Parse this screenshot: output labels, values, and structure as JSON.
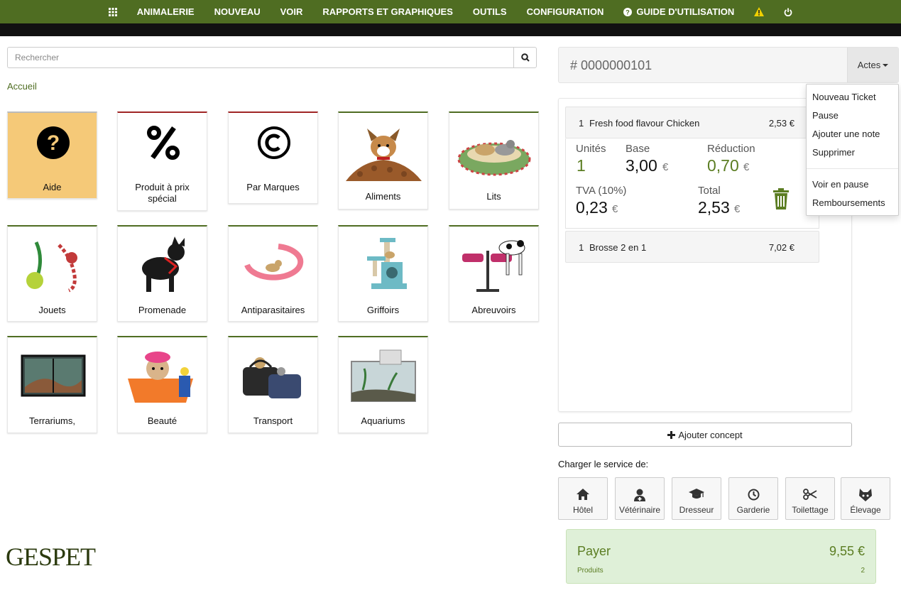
{
  "nav": {
    "items": [
      {
        "label": ""
      },
      {
        "label": "ANIMALERIE"
      },
      {
        "label": "NOUVEAU"
      },
      {
        "label": "VOIR"
      },
      {
        "label": "RAPPORTS ET GRAPHIQUES"
      },
      {
        "label": "OUTILS"
      },
      {
        "label": "CONFIGURATION"
      },
      {
        "label": "GUIDE D'UTILISATION"
      },
      {
        "label": ""
      },
      {
        "label": ""
      }
    ],
    "icons": [
      "grid-icon",
      "question-circle-icon",
      "warning-icon",
      "power-icon"
    ]
  },
  "search": {
    "placeholder": "Rechercher",
    "value": ""
  },
  "breadcrumb": "Accueil",
  "tiles": [
    {
      "label": "Aide"
    },
    {
      "label": "Produit à prix spécial"
    },
    {
      "label": "Par Marques"
    },
    {
      "label": "Aliments"
    },
    {
      "label": "Lits"
    },
    {
      "label": "Jouets"
    },
    {
      "label": "Promenade"
    },
    {
      "label": "Antiparasitaires"
    },
    {
      "label": "Griffoirs"
    },
    {
      "label": "Abreuvoirs"
    },
    {
      "label": "Terrariums,"
    },
    {
      "label": "Beauté"
    },
    {
      "label": "Transport"
    },
    {
      "label": "Aquariums"
    }
  ],
  "ticket": {
    "hash": "#",
    "number": "0000000101",
    "actes": "Actes",
    "lines": [
      {
        "qty": "1",
        "name": "Fresh food flavour Chicken",
        "price": "2,53 €"
      },
      {
        "qty": "1",
        "name": "Brosse 2 en 1",
        "price": "7,02 €"
      }
    ],
    "detail": {
      "units_label": "Unités",
      "units": "1",
      "base_label": "Base",
      "base": "3,00",
      "reduction_label": "Réduction",
      "reduction": "0,70",
      "tva_label": "TVA (10%)",
      "tva": "0,23",
      "total_label": "Total",
      "total": "2,53",
      "currency": "€"
    }
  },
  "dropdown": {
    "items": [
      "Nouveau Ticket",
      "Pause",
      "Ajouter une note",
      "Supprimer",
      "Voir en pause",
      "Remboursements"
    ]
  },
  "add_concept": "Ajouter concept",
  "services": {
    "title": "Charger le service de:",
    "items": [
      {
        "label": "Hôtel",
        "icon": "home-icon"
      },
      {
        "label": "Vétérinaire",
        "icon": "doctor-icon"
      },
      {
        "label": "Dresseur",
        "icon": "graduation-cap-icon"
      },
      {
        "label": "Garderie",
        "icon": "clock-icon"
      },
      {
        "label": "Toilettage",
        "icon": "scissors-icon"
      },
      {
        "label": "Élevage",
        "icon": "cat-icon"
      }
    ]
  },
  "pay": {
    "label": "Payer",
    "amount": "9,55 €",
    "sub_label": "Produits",
    "count": "2"
  },
  "logo": "GESPET",
  "colors": {
    "primary": "#4f6d22",
    "help_tile": "#f5c978",
    "pay_bg": "#dff0d8",
    "trash": "#5b7d22"
  }
}
